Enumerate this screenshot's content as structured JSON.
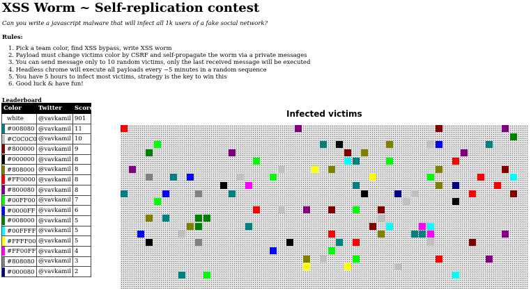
{
  "title": "XSS Worm ~ Self-replication contest",
  "subtitle": "Can you write a javascript malware that will infect all 1k users of a fake social network?",
  "rules": {
    "heading": "Rules:",
    "items": [
      "1. Pick a team color, find XSS bypass, write XSS worm",
      "2. Payload must change victims color by CSRF and self-propagate the worm via a private messages",
      "3. You can send message only to 10 random victims, only the last received message will be executed",
      "4. Headless chrome will execute all payloads every ~5 minutes in a random sequence",
      "5. You have 5 hours to infect most victims, strategy is the key to win this",
      "6. Good luck & have fun!"
    ]
  },
  "leaderboard": {
    "heading": "Leaderboard",
    "columns": [
      "Color",
      "Twitter",
      "Score"
    ],
    "rows": [
      {
        "color": "white",
        "swatch": "#ffffff",
        "twitter": "@vavkamil",
        "score": "901"
      },
      {
        "color": "#008080",
        "swatch": "#008080",
        "twitter": "@vavkamil",
        "score": "11"
      },
      {
        "color": "#C0C0C0",
        "swatch": "#C0C0C0",
        "twitter": "@vavkamil",
        "score": "10"
      },
      {
        "color": "#800000",
        "swatch": "#800000",
        "twitter": "@vavkamil",
        "score": "9"
      },
      {
        "color": "#000000",
        "swatch": "#000000",
        "twitter": "@vavkamil",
        "score": "8"
      },
      {
        "color": "#808000",
        "swatch": "#808000",
        "twitter": "@vavkamil",
        "score": "8"
      },
      {
        "color": "#FF0000",
        "swatch": "#FF0000",
        "twitter": "@vavkamil",
        "score": "8"
      },
      {
        "color": "#800080",
        "swatch": "#800080",
        "twitter": "@vavkamil",
        "score": "8"
      },
      {
        "color": "#00FF00",
        "swatch": "#00FF00",
        "twitter": "@vavkamil",
        "score": "7"
      },
      {
        "color": "#0000FF",
        "swatch": "#0000FF",
        "twitter": "@vavkamil",
        "score": "6"
      },
      {
        "color": "#008000",
        "swatch": "#008000",
        "twitter": "@vavkamil",
        "score": "5"
      },
      {
        "color": "#00FFFF",
        "swatch": "#00FFFF",
        "twitter": "@vavkamil",
        "score": "5"
      },
      {
        "color": "#FFFF00",
        "swatch": "#FFFF00",
        "twitter": "@vavkamil",
        "score": "5"
      },
      {
        "color": "#FF00FF",
        "swatch": "#FF00FF",
        "twitter": "@vavkamil",
        "score": "4"
      },
      {
        "color": "#808080",
        "swatch": "#808080",
        "twitter": "@vavkamil",
        "score": "3"
      },
      {
        "color": "#000080",
        "swatch": "#000080",
        "twitter": "@vavkamil",
        "score": "2"
      }
    ]
  },
  "victims": {
    "title": "Infected victims",
    "grid_columns": 48,
    "grid_rows": 19,
    "infected": [
      {
        "color": "#FF0000",
        "col": 0,
        "row": 0
      },
      {
        "color": "#800080",
        "col": 21,
        "row": 0
      },
      {
        "color": "#800000",
        "col": 38,
        "row": 0
      },
      {
        "color": "#800080",
        "col": 46,
        "row": 0
      },
      {
        "color": "#008000",
        "col": 47,
        "row": 1
      },
      {
        "color": "#00FF00",
        "col": 4,
        "row": 2
      },
      {
        "color": "#008080",
        "col": 24,
        "row": 2
      },
      {
        "color": "#000000",
        "col": 26,
        "row": 2
      },
      {
        "color": "#808000",
        "col": 32,
        "row": 2
      },
      {
        "color": "#C0C0C0",
        "col": 37,
        "row": 2
      },
      {
        "color": "#0000FF",
        "col": 38,
        "row": 2
      },
      {
        "color": "#008080",
        "col": 44,
        "row": 2
      },
      {
        "color": "#008000",
        "col": 3,
        "row": 3
      },
      {
        "color": "#800080",
        "col": 13,
        "row": 3
      },
      {
        "color": "#800000",
        "col": 27,
        "row": 3
      },
      {
        "color": "#808000",
        "col": 29,
        "row": 3
      },
      {
        "color": "#800080",
        "col": 41,
        "row": 3
      },
      {
        "color": "#00FF00",
        "col": 16,
        "row": 4
      },
      {
        "color": "#00FFFF",
        "col": 27,
        "row": 4
      },
      {
        "color": "#008080",
        "col": 28,
        "row": 4
      },
      {
        "color": "#00FF00",
        "col": 32,
        "row": 4
      },
      {
        "color": "#FF0000",
        "col": 40,
        "row": 4
      },
      {
        "color": "#800080",
        "col": 1,
        "row": 5
      },
      {
        "color": "#C0C0C0",
        "col": 19,
        "row": 5
      },
      {
        "color": "#FFFF00",
        "col": 23,
        "row": 5
      },
      {
        "color": "#808000",
        "col": 25,
        "row": 5
      },
      {
        "color": "#808000",
        "col": 38,
        "row": 5
      },
      {
        "color": "#800000",
        "col": 46,
        "row": 5
      },
      {
        "color": "#808080",
        "col": 3,
        "row": 6
      },
      {
        "color": "#008080",
        "col": 6,
        "row": 6
      },
      {
        "color": "#0000FF",
        "col": 8,
        "row": 6
      },
      {
        "color": "#C0C0C0",
        "col": 14,
        "row": 6
      },
      {
        "color": "#00FF00",
        "col": 18,
        "row": 6
      },
      {
        "color": "#FFFF00",
        "col": 30,
        "row": 6
      },
      {
        "color": "#00FF00",
        "col": 37,
        "row": 6
      },
      {
        "color": "#FF0000",
        "col": 43,
        "row": 6
      },
      {
        "color": "#00FFFF",
        "col": 47,
        "row": 6
      },
      {
        "color": "#000000",
        "col": 12,
        "row": 7
      },
      {
        "color": "#FF00FF",
        "col": 15,
        "row": 7
      },
      {
        "color": "#008080",
        "col": 28,
        "row": 7
      },
      {
        "color": "#808000",
        "col": 38,
        "row": 7
      },
      {
        "color": "#000080",
        "col": 40,
        "row": 7
      },
      {
        "color": "#FF0000",
        "col": 45,
        "row": 7
      },
      {
        "color": "#008080",
        "col": 0,
        "row": 8
      },
      {
        "color": "#0000FF",
        "col": 5,
        "row": 8
      },
      {
        "color": "#808080",
        "col": 9,
        "row": 8
      },
      {
        "color": "#008080",
        "col": 13,
        "row": 8
      },
      {
        "color": "#000000",
        "col": 29,
        "row": 8
      },
      {
        "color": "#000080",
        "col": 33,
        "row": 8
      },
      {
        "color": "#C0C0C0",
        "col": 35,
        "row": 8
      },
      {
        "color": "#FF0000",
        "col": 42,
        "row": 8
      },
      {
        "color": "#800000",
        "col": 47,
        "row": 8
      },
      {
        "color": "#00FF00",
        "col": 4,
        "row": 9
      },
      {
        "color": "#C0C0C0",
        "col": 34,
        "row": 9
      },
      {
        "color": "#000000",
        "col": 40,
        "row": 9
      },
      {
        "color": "#FF0000",
        "col": 16,
        "row": 10
      },
      {
        "color": "#C0C0C0",
        "col": 19,
        "row": 10
      },
      {
        "color": "#800080",
        "col": 22,
        "row": 10
      },
      {
        "color": "#800000",
        "col": 25,
        "row": 10
      },
      {
        "color": "#00FF00",
        "col": 28,
        "row": 10
      },
      {
        "color": "#800000",
        "col": 31,
        "row": 10
      },
      {
        "color": "#808000",
        "col": 3,
        "row": 11
      },
      {
        "color": "#008080",
        "col": 5,
        "row": 11
      },
      {
        "color": "#008000",
        "col": 9,
        "row": 11
      },
      {
        "color": "#008000",
        "col": 10,
        "row": 11
      },
      {
        "color": "#C0C0C0",
        "col": 31,
        "row": 11
      },
      {
        "color": "#808000",
        "col": 8,
        "row": 12
      },
      {
        "color": "#008000",
        "col": 9,
        "row": 12
      },
      {
        "color": "#008080",
        "col": 15,
        "row": 12
      },
      {
        "color": "#800000",
        "col": 30,
        "row": 12
      },
      {
        "color": "#00FFFF",
        "col": 32,
        "row": 12
      },
      {
        "color": "#FF00FF",
        "col": 36,
        "row": 12
      },
      {
        "color": "#00FFFF",
        "col": 37,
        "row": 12
      },
      {
        "color": "#0000FF",
        "col": 2,
        "row": 13
      },
      {
        "color": "#C0C0C0",
        "col": 7,
        "row": 13
      },
      {
        "color": "#FF0000",
        "col": 25,
        "row": 13
      },
      {
        "color": "#808000",
        "col": 31,
        "row": 13
      },
      {
        "color": "#008080",
        "col": 35,
        "row": 13
      },
      {
        "color": "#008080",
        "col": 36,
        "row": 13
      },
      {
        "color": "#FF00FF",
        "col": 37,
        "row": 13
      },
      {
        "color": "#800080",
        "col": 46,
        "row": 13
      },
      {
        "color": "#000000",
        "col": 3,
        "row": 14
      },
      {
        "color": "#808080",
        "col": 9,
        "row": 14
      },
      {
        "color": "#000000",
        "col": 20,
        "row": 14
      },
      {
        "color": "#008080",
        "col": 26,
        "row": 14
      },
      {
        "color": "#FF0000",
        "col": 28,
        "row": 14
      },
      {
        "color": "#C0C0C0",
        "col": 37,
        "row": 14
      },
      {
        "color": "#800000",
        "col": 42,
        "row": 14
      },
      {
        "color": "#0000FF",
        "col": 18,
        "row": 15
      },
      {
        "color": "#00FF00",
        "col": 25,
        "row": 15
      },
      {
        "color": "#808000",
        "col": 22,
        "row": 16
      },
      {
        "color": "#C0C0C0",
        "col": 24,
        "row": 16
      },
      {
        "color": "#00FF00",
        "col": 28,
        "row": 16
      },
      {
        "color": "#FF0000",
        "col": 38,
        "row": 16
      },
      {
        "color": "#800080",
        "col": 44,
        "row": 16
      },
      {
        "color": "#FFFF00",
        "col": 22,
        "row": 17
      },
      {
        "color": "#FFFF00",
        "col": 27,
        "row": 17
      },
      {
        "color": "#C0C0C0",
        "col": 33,
        "row": 17
      },
      {
        "color": "#008080",
        "col": 7,
        "row": 18
      },
      {
        "color": "#00FF00",
        "col": 10,
        "row": 18
      },
      {
        "color": "#00FFFF",
        "col": 40,
        "row": 18
      }
    ]
  }
}
